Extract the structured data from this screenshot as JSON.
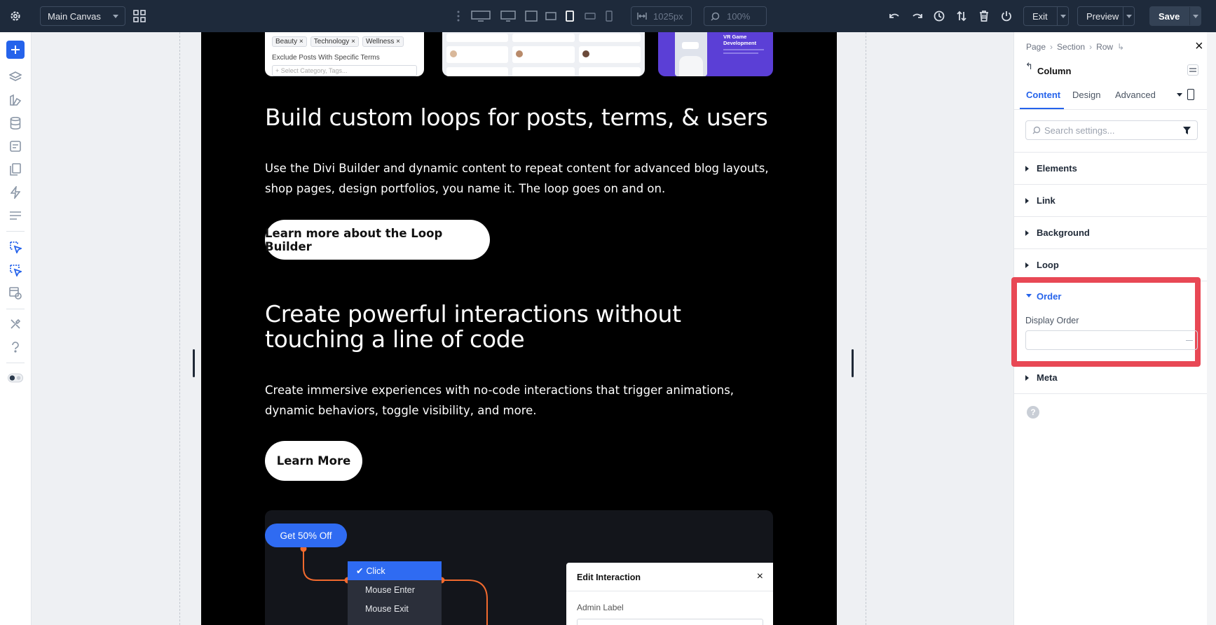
{
  "toolbar": {
    "canvas_select": "Main Canvas",
    "width_value": "1025px",
    "zoom_value": "100%",
    "exit_label": "Exit",
    "preview_label": "Preview",
    "save_label": "Save"
  },
  "page": {
    "top_tags": [
      "Beauty",
      "Technology",
      "Wellness"
    ],
    "exclude_label": "Exclude Posts With Specific Terms",
    "exclude_placeholder": "+ Select Category, Tags...",
    "card3_title": "VR Game Development",
    "heading_loops": "Build custom loops for posts, terms, & users",
    "para_loops": "Use the Divi Builder and dynamic content to repeat content for advanced blog layouts, shop pages, design portfolios, you name it. The loop goes on and on.",
    "btn_loops": "Learn more about the Loop Builder",
    "heading_interactions": "Create powerful interactions without touching a line of code",
    "para_interactions": "Create immersive experiences with no-code interactions that trigger animations, dynamic behaviors, toggle visibility, and more.",
    "btn_interactions": "Learn More",
    "demo": {
      "offer_button": "Get 50% Off",
      "trigger_menu": [
        "Click",
        "Mouse Enter",
        "Mouse Exit"
      ],
      "edit_title": "Edit Interaction",
      "admin_label": "Admin Label"
    }
  },
  "panel": {
    "breadcrumb": [
      "Page",
      "Section",
      "Row"
    ],
    "title": "Column",
    "tabs": [
      "Content",
      "Design",
      "Advanced"
    ],
    "search_placeholder": "Search settings...",
    "groups": [
      "Elements",
      "Link",
      "Background",
      "Loop"
    ],
    "order_group": "Order",
    "display_order_label": "Display Order",
    "display_order_value": "",
    "meta_group": "Meta"
  },
  "colors": {
    "topbar": "#1e2a3b",
    "accent": "#2563eb",
    "highlight": "#e84855",
    "save": "#344255"
  }
}
